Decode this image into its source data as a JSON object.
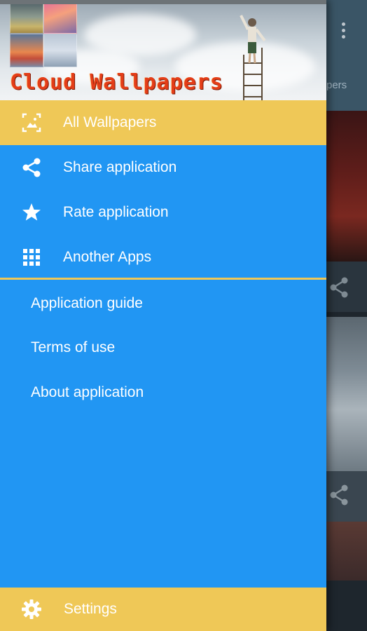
{
  "app_title": "Cloud Wallpapers",
  "background_app": {
    "tab_fragment": "pers",
    "menu_icon": "overflow-menu-icon",
    "card_icons": [
      "share-icon",
      "share-icon"
    ]
  },
  "drawer": {
    "primary_items": [
      {
        "label": "All Wallpapers",
        "icon": "wallpaper-icon",
        "active": true
      },
      {
        "label": "Share application",
        "icon": "share-icon",
        "active": false
      },
      {
        "label": "Rate application",
        "icon": "star-icon",
        "active": false
      },
      {
        "label": "Another Apps",
        "icon": "apps-grid-icon",
        "active": false
      }
    ],
    "secondary_items": [
      {
        "label": "Application guide"
      },
      {
        "label": "Terms of use"
      },
      {
        "label": "About application"
      }
    ],
    "footer": {
      "label": "Settings",
      "icon": "gear-icon"
    }
  },
  "colors": {
    "drawer_bg": "#2196f3",
    "accent_yellow": "#efc857",
    "text": "#ffffff",
    "title_red": "#e43d18"
  }
}
